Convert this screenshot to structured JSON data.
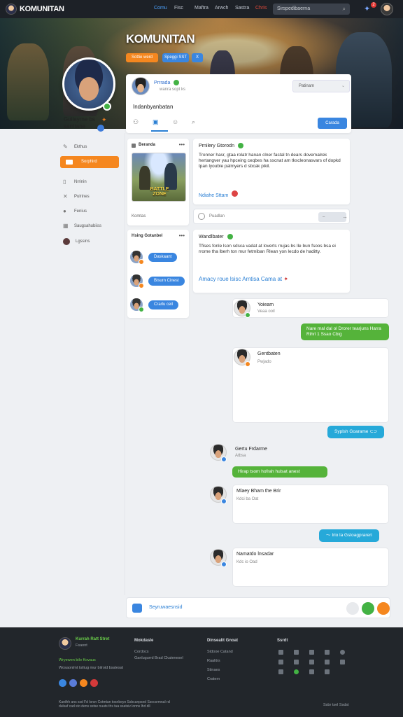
{
  "nav": {
    "logo_text": "KOMUNITAN",
    "links": [
      "Comu",
      "Fisc",
      "Maftra",
      "Arwch",
      "Sastra",
      "Chris"
    ],
    "search_placeholder": "Sirspedibaerna",
    "notif_count": "2"
  },
  "banner": {
    "title": "KOMUNITAN",
    "btn1": "Sottie werd",
    "btn2": "Speggi SST",
    "btn3": "X"
  },
  "profile": {
    "name": "Guilayrne bs sarritane"
  },
  "sidebar": {
    "item_top": "Ekthus",
    "orange_btn": "Sorphird",
    "items": [
      "Nrrinin",
      "Pulrines",
      "Fenius",
      "Saugsahubiiss",
      "Lgssins"
    ]
  },
  "postbox": {
    "name": "Prrrada",
    "sub": "wanra sopt ks",
    "text": "Indanbyanbatan",
    "select": "Patinam",
    "post_btn": "Carada"
  },
  "card_game": {
    "header": "Beranda",
    "game_title": "BATTLE ZONE",
    "footer": "Komtas"
  },
  "card_friends": {
    "header": "Hsing Gotanbel",
    "buttons": [
      "Daskaant",
      "Bisurn Cinest",
      "Crarlu ceil"
    ]
  },
  "post1": {
    "title": "Prnilery Gtorodn",
    "body": "Tronner hasr, gtaa rolatr hanan clner fastal tn dears dovemalrek hertangver yau hpceing ceqbes ha sscnat am tkscleonasvars of dopkd tpan lyouble palmyers d sbcak pikil.",
    "link": "Ndiahe Sttam"
  },
  "searchbar": {
    "placeholder": "Puadlan",
    "btn": "–"
  },
  "post2": {
    "title": "Wandlbater",
    "body": "Tfises fonle lson sdsca vadat at loverts rrujas bs lle bun fsoos bsa ei rrome tha lberh ton mur fetmiban Rlean yon lecdo de haditty.",
    "link": "Amacy roue lsisc Amtisa Cama at"
  },
  "chat": {
    "m1_name": "Yoieam",
    "m1_sub": "Veaa ooil",
    "green1": "Nare mal dal ol Drorer tearjuns Harra Rihrl 1 Ssao Cbig",
    "m2_name": "Gentbaten",
    "m2_sub": "Pwjado",
    "teal1": "Syplsh Goarame",
    "m3_name": "Gertu Frdarme",
    "m3_sub": "Atbsa",
    "green2": "Hirap tsom hofrah hulsat anest",
    "m4_name": "Mlaey Bham the Brir",
    "m4_sub": "Kdci ba Oat",
    "teal2": "Irio la Gstoagprareri",
    "m5_name": "Namatdo lnsadar",
    "m5_sub": "Kdc io Oad"
  },
  "composer": {
    "placeholder": "Seyruwaesnsid"
  },
  "footer": {
    "brand": "Kurrah Ratt Stret",
    "brand_sub": "Fsaont",
    "link_label": "Wryewen bilo Kovaus",
    "tagline": "Wosaonlmt tsiliug mur bilroid bsalesal",
    "col1_h": "Mokdasle",
    "col1_items": [
      "Cordocs",
      "Ganlugurrd Brad Ckatenesel"
    ],
    "col2_h": "Dinsealit Gnoat",
    "col2_items": [
      "Stdooe Catand",
      "Raalitrs",
      "Stinaes",
      "Cratern"
    ],
    "col3_h": "Ssrdt",
    "copyright": "Kardhh ans ssd Fd lorsn Cotmtan tosnbeyo Ssbcanpsed Ssocsrmnal rsl dulsaf cad sto dens sstse nuuts ths tua ssatsiv lonns lhd dll",
    "bottom_right": "Ssbr tsel Ssdst"
  }
}
